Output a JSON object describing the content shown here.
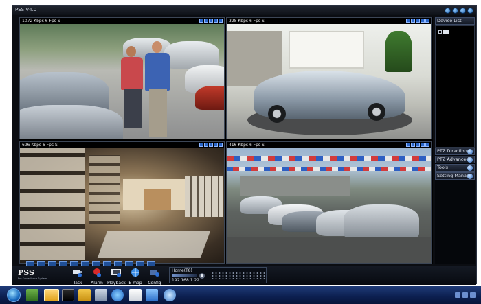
{
  "app": {
    "title": "PSS  V4.0"
  },
  "panes": [
    {
      "label": "1072 Kbps 6 Fps S"
    },
    {
      "label": "328 Kbps 6 Fps S"
    },
    {
      "label": "696 Kbps 6 Fps S"
    },
    {
      "label": "416 Kbps 6 Fps S"
    }
  ],
  "sidebar": {
    "device_list": "Device List",
    "ptz_direction": "PTZ Direction",
    "ptz_advanced": "PTZ Advanced",
    "tools": "Tools",
    "setting_manage": "Setting Manage"
  },
  "logo": {
    "text": "PSS",
    "tagline": "Pro Surveillance System"
  },
  "toolbar": {
    "task": "Task",
    "alarm": "Alarm",
    "playback": "Playback",
    "emap": "E-map",
    "config": "Config"
  },
  "status": {
    "home": "Home(T8)",
    "ip": "192.168.1.22"
  },
  "colors": {
    "accent": "#2a66c8",
    "background": "#0b0d12"
  }
}
